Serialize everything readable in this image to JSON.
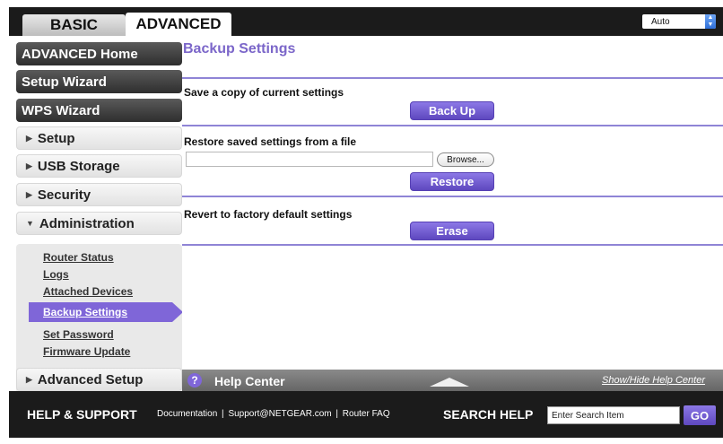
{
  "tabs": {
    "basic": "BASIC",
    "advanced": "ADVANCED"
  },
  "language_select": {
    "value": "Auto"
  },
  "sidebar": {
    "advanced_home": "ADVANCED Home",
    "setup_wizard": "Setup Wizard",
    "wps_wizard": "WPS Wizard",
    "setup": "Setup",
    "usb_storage": "USB Storage",
    "security": "Security",
    "administration": "Administration",
    "admin_links": [
      "Router Status",
      "Logs",
      "Attached Devices",
      "Backup Settings",
      "Set Password",
      "Firmware Update"
    ],
    "advanced_setup": "Advanced Setup"
  },
  "main": {
    "title": "Backup Settings",
    "save_label": "Save a copy of current settings",
    "backup_button": "Back Up",
    "restore_label": "Restore saved settings from a file",
    "file_value": "",
    "browse_button": "Browse...",
    "restore_button": "Restore",
    "revert_label": "Revert to factory default settings",
    "erase_button": "Erase"
  },
  "help_center": {
    "title": "Help Center",
    "toggle": "Show/Hide Help Center",
    "icon": "?"
  },
  "footer": {
    "help_support": "HELP & SUPPORT",
    "links": [
      "Documentation",
      "Support@NETGEAR.com",
      "Router FAQ"
    ],
    "separator": "|",
    "search_help": "SEARCH HELP",
    "search_value": "Enter Search Item",
    "go_button": "GO"
  },
  "colors": {
    "accent": "#7f66d8",
    "dark": "#1b1b1b"
  }
}
